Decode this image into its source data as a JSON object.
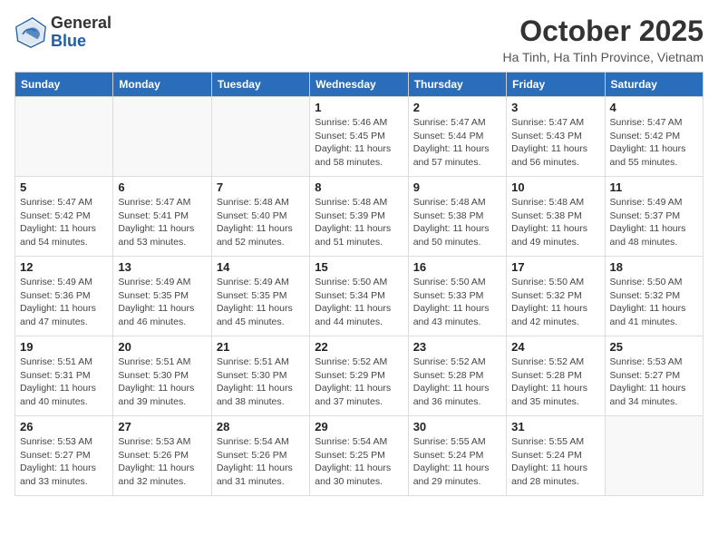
{
  "header": {
    "logo_general": "General",
    "logo_blue": "Blue",
    "month": "October 2025",
    "location": "Ha Tinh, Ha Tinh Province, Vietnam"
  },
  "days_of_week": [
    "Sunday",
    "Monday",
    "Tuesday",
    "Wednesday",
    "Thursday",
    "Friday",
    "Saturday"
  ],
  "weeks": [
    [
      {
        "day": "",
        "info": ""
      },
      {
        "day": "",
        "info": ""
      },
      {
        "day": "",
        "info": ""
      },
      {
        "day": "1",
        "info": "Sunrise: 5:46 AM\nSunset: 5:45 PM\nDaylight: 11 hours and 58 minutes."
      },
      {
        "day": "2",
        "info": "Sunrise: 5:47 AM\nSunset: 5:44 PM\nDaylight: 11 hours and 57 minutes."
      },
      {
        "day": "3",
        "info": "Sunrise: 5:47 AM\nSunset: 5:43 PM\nDaylight: 11 hours and 56 minutes."
      },
      {
        "day": "4",
        "info": "Sunrise: 5:47 AM\nSunset: 5:42 PM\nDaylight: 11 hours and 55 minutes."
      }
    ],
    [
      {
        "day": "5",
        "info": "Sunrise: 5:47 AM\nSunset: 5:42 PM\nDaylight: 11 hours and 54 minutes."
      },
      {
        "day": "6",
        "info": "Sunrise: 5:47 AM\nSunset: 5:41 PM\nDaylight: 11 hours and 53 minutes."
      },
      {
        "day": "7",
        "info": "Sunrise: 5:48 AM\nSunset: 5:40 PM\nDaylight: 11 hours and 52 minutes."
      },
      {
        "day": "8",
        "info": "Sunrise: 5:48 AM\nSunset: 5:39 PM\nDaylight: 11 hours and 51 minutes."
      },
      {
        "day": "9",
        "info": "Sunrise: 5:48 AM\nSunset: 5:38 PM\nDaylight: 11 hours and 50 minutes."
      },
      {
        "day": "10",
        "info": "Sunrise: 5:48 AM\nSunset: 5:38 PM\nDaylight: 11 hours and 49 minutes."
      },
      {
        "day": "11",
        "info": "Sunrise: 5:49 AM\nSunset: 5:37 PM\nDaylight: 11 hours and 48 minutes."
      }
    ],
    [
      {
        "day": "12",
        "info": "Sunrise: 5:49 AM\nSunset: 5:36 PM\nDaylight: 11 hours and 47 minutes."
      },
      {
        "day": "13",
        "info": "Sunrise: 5:49 AM\nSunset: 5:35 PM\nDaylight: 11 hours and 46 minutes."
      },
      {
        "day": "14",
        "info": "Sunrise: 5:49 AM\nSunset: 5:35 PM\nDaylight: 11 hours and 45 minutes."
      },
      {
        "day": "15",
        "info": "Sunrise: 5:50 AM\nSunset: 5:34 PM\nDaylight: 11 hours and 44 minutes."
      },
      {
        "day": "16",
        "info": "Sunrise: 5:50 AM\nSunset: 5:33 PM\nDaylight: 11 hours and 43 minutes."
      },
      {
        "day": "17",
        "info": "Sunrise: 5:50 AM\nSunset: 5:32 PM\nDaylight: 11 hours and 42 minutes."
      },
      {
        "day": "18",
        "info": "Sunrise: 5:50 AM\nSunset: 5:32 PM\nDaylight: 11 hours and 41 minutes."
      }
    ],
    [
      {
        "day": "19",
        "info": "Sunrise: 5:51 AM\nSunset: 5:31 PM\nDaylight: 11 hours and 40 minutes."
      },
      {
        "day": "20",
        "info": "Sunrise: 5:51 AM\nSunset: 5:30 PM\nDaylight: 11 hours and 39 minutes."
      },
      {
        "day": "21",
        "info": "Sunrise: 5:51 AM\nSunset: 5:30 PM\nDaylight: 11 hours and 38 minutes."
      },
      {
        "day": "22",
        "info": "Sunrise: 5:52 AM\nSunset: 5:29 PM\nDaylight: 11 hours and 37 minutes."
      },
      {
        "day": "23",
        "info": "Sunrise: 5:52 AM\nSunset: 5:28 PM\nDaylight: 11 hours and 36 minutes."
      },
      {
        "day": "24",
        "info": "Sunrise: 5:52 AM\nSunset: 5:28 PM\nDaylight: 11 hours and 35 minutes."
      },
      {
        "day": "25",
        "info": "Sunrise: 5:53 AM\nSunset: 5:27 PM\nDaylight: 11 hours and 34 minutes."
      }
    ],
    [
      {
        "day": "26",
        "info": "Sunrise: 5:53 AM\nSunset: 5:27 PM\nDaylight: 11 hours and 33 minutes."
      },
      {
        "day": "27",
        "info": "Sunrise: 5:53 AM\nSunset: 5:26 PM\nDaylight: 11 hours and 32 minutes."
      },
      {
        "day": "28",
        "info": "Sunrise: 5:54 AM\nSunset: 5:26 PM\nDaylight: 11 hours and 31 minutes."
      },
      {
        "day": "29",
        "info": "Sunrise: 5:54 AM\nSunset: 5:25 PM\nDaylight: 11 hours and 30 minutes."
      },
      {
        "day": "30",
        "info": "Sunrise: 5:55 AM\nSunset: 5:24 PM\nDaylight: 11 hours and 29 minutes."
      },
      {
        "day": "31",
        "info": "Sunrise: 5:55 AM\nSunset: 5:24 PM\nDaylight: 11 hours and 28 minutes."
      },
      {
        "day": "",
        "info": ""
      }
    ]
  ]
}
